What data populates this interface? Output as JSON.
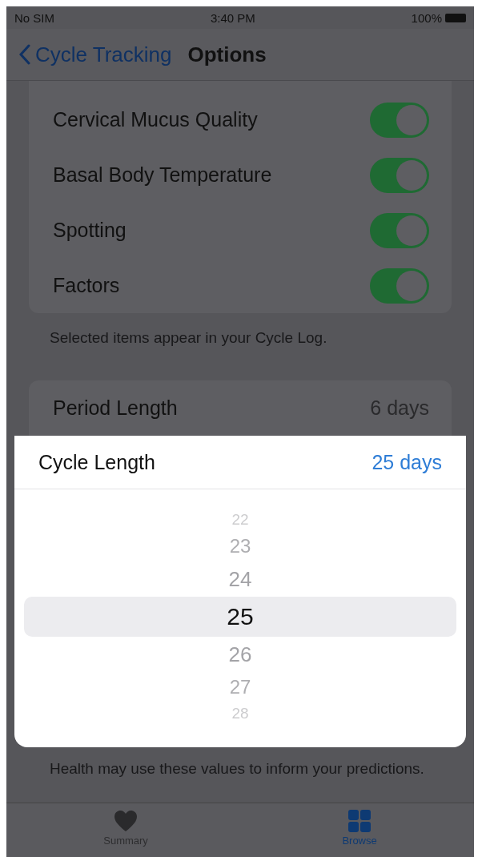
{
  "status_bar": {
    "carrier": "No SIM",
    "time": "3:40 PM",
    "battery": "100%"
  },
  "nav": {
    "back": "Cycle Tracking",
    "title": "Options"
  },
  "log_items": [
    {
      "label": "Cervical Mucus Quality",
      "on": true
    },
    {
      "label": "Basal Body Temperature",
      "on": true
    },
    {
      "label": "Spotting",
      "on": true
    },
    {
      "label": "Factors",
      "on": true
    }
  ],
  "log_footer": "Selected items appear in your Cycle Log.",
  "period_length": {
    "label": "Period Length",
    "value": "6 days"
  },
  "cycle_length": {
    "label": "Cycle Length",
    "value": "25 days"
  },
  "picker": [
    {
      "label": "22",
      "selected": false
    },
    {
      "label": "23",
      "selected": false
    },
    {
      "label": "24",
      "selected": false
    },
    {
      "label": "25",
      "selected": true
    },
    {
      "label": "26",
      "selected": false
    },
    {
      "label": "27",
      "selected": false
    },
    {
      "label": "28",
      "selected": false
    }
  ],
  "lengths_footer": "Health may use these values to inform your predictions.",
  "tabs": [
    {
      "label": "Summary",
      "kind": "heart",
      "selected": false
    },
    {
      "label": "Browse",
      "kind": "grid",
      "selected": true
    }
  ]
}
